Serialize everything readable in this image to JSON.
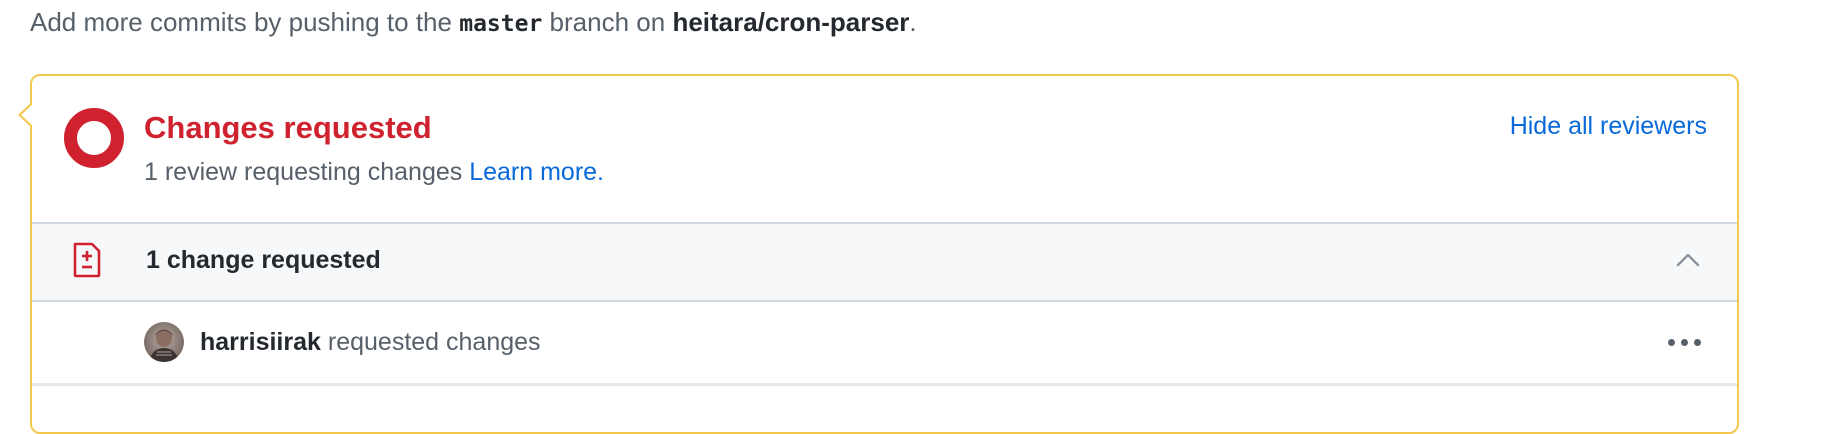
{
  "push_hint": {
    "prefix": "Add more commits by pushing to the",
    "branch": "master",
    "middle": "branch on",
    "repo": "heitara/cron-parser",
    "suffix": "."
  },
  "merge_status": {
    "title": "Changes requested",
    "subtitle": "1 review requesting changes",
    "learn_more": "Learn more.",
    "hide_reviewers": "Hide all reviewers",
    "accent_color": "#cf222e",
    "border_color": "#f2c94c"
  },
  "changes_section": {
    "title": "1 change requested",
    "icon": "file-diff-icon",
    "collapse_icon": "chevron-up-icon"
  },
  "reviewers": [
    {
      "name": "harrisiirak",
      "action": "requested changes",
      "menu_icon": "kebab-horizontal-icon"
    }
  ]
}
